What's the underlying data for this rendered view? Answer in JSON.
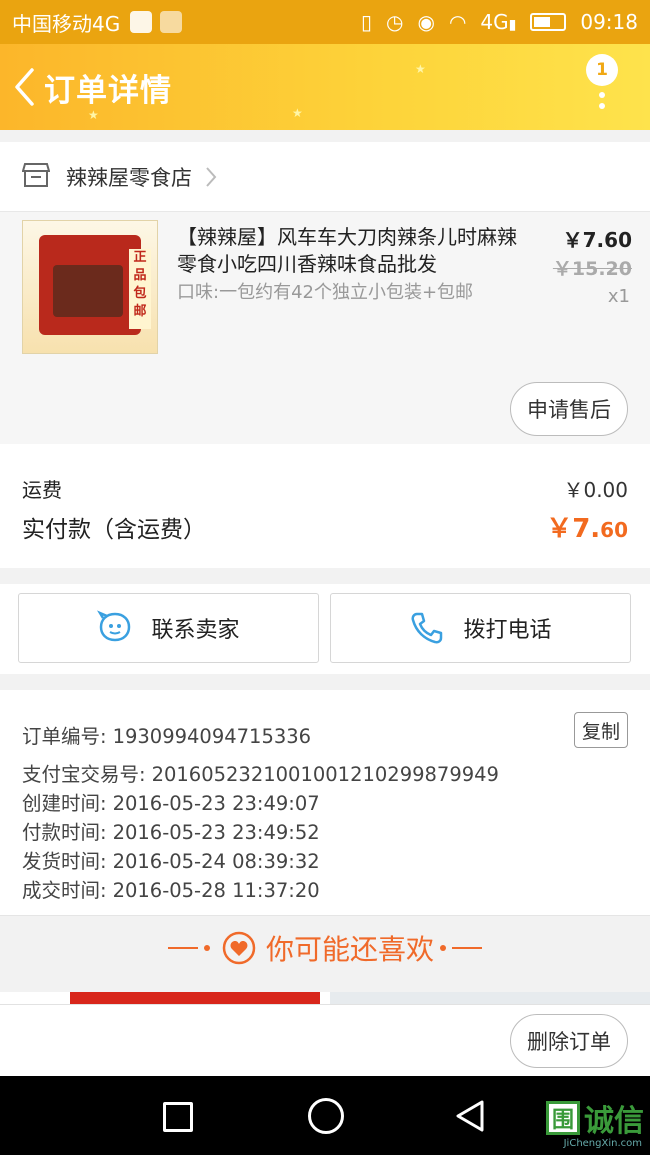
{
  "status_bar": {
    "carrier": "中国移动4G",
    "network": "4G",
    "time": "09:18"
  },
  "header": {
    "title": "订单详情",
    "badge_count": "1"
  },
  "shop": {
    "name": "辣辣屋零食店"
  },
  "product": {
    "title": "【辣辣屋】风车车大刀肉辣条儿时麻辣零食小吃四川香辣味食品批发",
    "variant": "口味:一包约有42个独立小包装+包邮",
    "price": "￥7.60",
    "original_price": "￥15.20",
    "quantity": "x1",
    "thumb_tag": "正品包邮",
    "aftersale_label": "申请售后"
  },
  "fees": {
    "shipping_label": "运费",
    "shipping_value": "￥0.00",
    "total_label": "实付款（含运费）",
    "total_main": "￥7.",
    "total_cents": "60"
  },
  "contact": {
    "seller_label": "联系卖家",
    "call_label": "拨打电话"
  },
  "order_info": {
    "order_no_label": "订单编号:",
    "order_no": "1930994094715336",
    "copy_label": "复制",
    "alipay_label": "支付宝交易号:",
    "alipay_no": "2016052321001001210299879949",
    "created_label": "创建时间:",
    "created": "2016-05-23 23:49:07",
    "paid_label": "付款时间:",
    "paid": "2016-05-23 23:49:52",
    "shipped_label": "发货时间:",
    "shipped": "2016-05-24 08:39:32",
    "completed_label": "成交时间:",
    "completed": "2016-05-28 11:37:20"
  },
  "recommend": {
    "title": "你可能还喜欢"
  },
  "bottom": {
    "delete_label": "删除订单"
  },
  "watermark": {
    "logo_char": "围",
    "text": "诚信",
    "sub": "JiChengXin.com"
  },
  "colors": {
    "status_bar": "#eaa410",
    "header_start": "#fcb62a",
    "header_end": "#fee34c",
    "accent_orange": "#f26a1f",
    "contact_blue": "#3aa0e0"
  },
  "icons": {
    "back": "chevron-left-icon",
    "more": "more-vertical-icon",
    "shop": "store-icon",
    "shop_arrow": "chevron-right-icon",
    "seller": "chat-bubble-icon",
    "call": "phone-icon",
    "recommend": "heart-icon"
  }
}
